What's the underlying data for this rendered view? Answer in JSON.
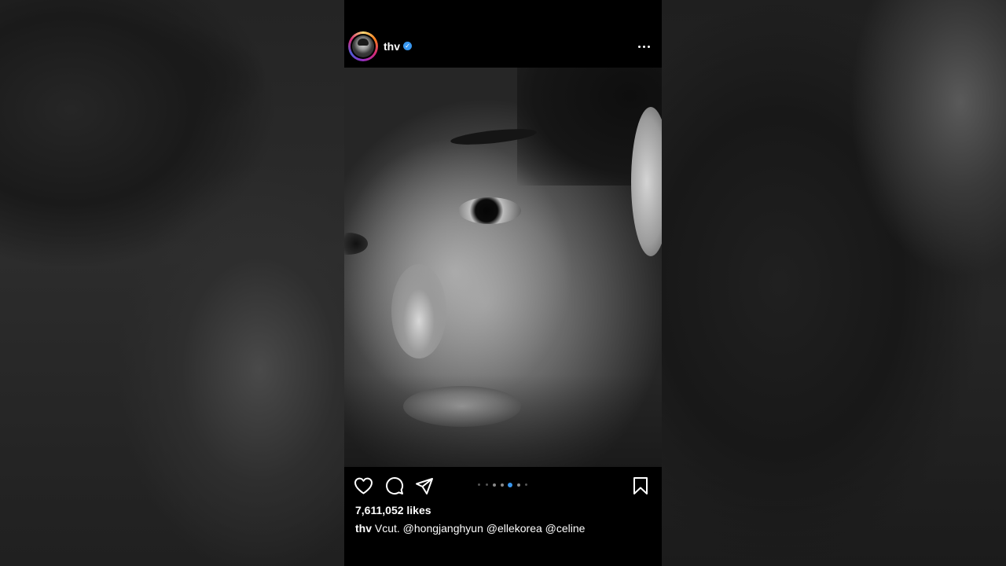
{
  "post": {
    "username": "thv",
    "verified_icon": "verified-badge-icon",
    "likes": "7,611,052 likes",
    "caption_user": "thv",
    "caption_text": "Vcut.  @hongjanghyun @ellekorea @celine",
    "carousel": {
      "count": 7,
      "active_index": 4
    }
  },
  "icons": {
    "more": "more-options-icon",
    "like": "heart-icon",
    "comment": "comment-icon",
    "share": "send-icon",
    "save": "bookmark-icon"
  },
  "colors": {
    "background": "#000000",
    "text": "#ffffff",
    "accent": "#3897f0"
  }
}
